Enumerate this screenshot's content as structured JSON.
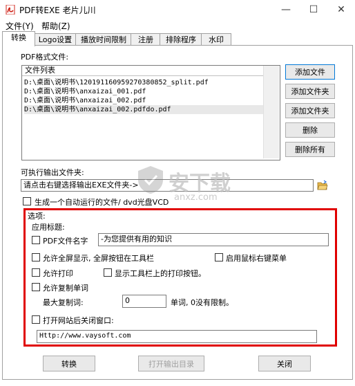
{
  "window": {
    "title": "PDF转EXE    老片儿川",
    "minimize_glyph": "—",
    "maximize_glyph": "☐",
    "close_glyph": "✕",
    "icon": "pdf-app-icon",
    "accent": "#d0261b"
  },
  "menu": {
    "file": "文件(Y)",
    "help": "帮助(Z)"
  },
  "tabs": [
    "转换",
    "Logo设置",
    "播放时间限制",
    "注册",
    "排除程序",
    "水印"
  ],
  "source": {
    "label": "PDF格式文件:",
    "list_header": "文件列表",
    "files": [
      "D:\\桌面\\说明书\\120191160959270380852_split.pdf",
      "D:\\桌面\\说明书\\anxaizai_001.pdf",
      "D:\\桌面\\说明书\\anxaizai_002.pdf",
      "D:\\桌面\\说明书\\anxaizai_002.pdfdo.pdf"
    ],
    "buttons": {
      "add_file": "添加文件",
      "add_folder_1": "添加文件夹",
      "add_folder_2": "添加文件夹",
      "delete": "删除",
      "delete_all": "删除所有"
    }
  },
  "output": {
    "label": "可执行输出文件夹:",
    "value": "请点击右键选择输出EXE文件夹->",
    "folder_icon": "folder-open-icon",
    "autorun_label": "生成一个自动运行的文件/ dvd光盘VCD"
  },
  "options": {
    "group_label": "选项:",
    "app_title_label": "应用标题:",
    "pdf_filename_label": "PDF文件名字",
    "pdf_filename_value": "-为您提供有用的知识",
    "fullscreen_label": "允许全屏显示, 全屏按钮在工具栏",
    "right_click_label": "启用鼠标右键菜单",
    "allow_print_label": "允许打印",
    "show_print_button_label": "显示工具栏上的打印按钮。",
    "allow_copy_label": "允许复制单词",
    "max_copy_label": "最大复制词:",
    "max_copy_value": "0",
    "max_copy_suffix": "单词, 0没有限制。",
    "open_site_label": "打开网站后关闭窗口:",
    "site_url": "Http://www.vaysoft.com"
  },
  "footer": {
    "convert": "转换",
    "open_output": "打开输出目录",
    "close": "关闭"
  },
  "watermark": {
    "text": "安下载",
    "domain": "anxz.com"
  }
}
